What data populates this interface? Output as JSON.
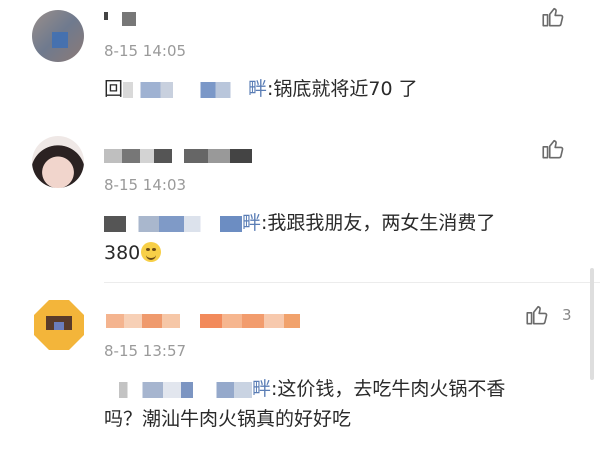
{
  "comments": [
    {
      "time": "8-15 14:05",
      "reply_prefix": "回",
      "body": ":锅底就将近70 了",
      "name_fragment": "",
      "mention_fragment": "畔"
    },
    {
      "time": "8-15 14:03",
      "name_fragment": "",
      "mention_fragment": "畔",
      "body_line1": ":我跟我朋友，两女生消费了",
      "body_line2": "380"
    },
    {
      "time": "8-15 13:57",
      "like_count": "3",
      "mention_fragment": "畔",
      "body_line1": ":这价钱，去吃牛肉火锅不香",
      "body_line2": "吗？潮汕牛肉火锅真的好好吃"
    }
  ],
  "colors": {
    "time": "#9a9a9a",
    "text": "#2a2a2a",
    "blur_blue": "#8aa4cf",
    "blur_gray": "#c9c9c9"
  },
  "icons": [
    "thumb-up-icon",
    "grin-emoji-icon"
  ]
}
